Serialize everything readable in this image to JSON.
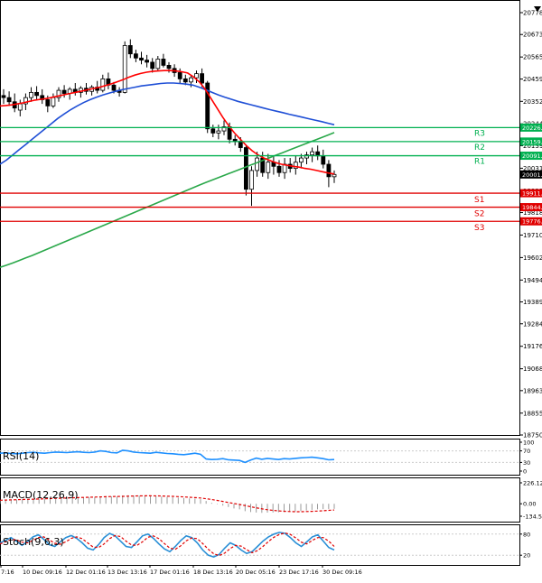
{
  "chart": {
    "corner_icon": "settings-icon",
    "colors": {
      "background": "#ffffff",
      "border": "#000000",
      "grid": "#d6d6d6",
      "candle_up": "#000000",
      "candle_down": "#000000",
      "ma_red": "#ff0000",
      "ma_blue": "#1f4fd6",
      "ma_green": "#2aa84a",
      "resistance": "#00b050",
      "support": "#e00000",
      "rsi_line": "#1e90ff",
      "macd_hist": "#9a9a9a",
      "macd_signal": "#e00000",
      "stoch_main": "#2a8fd6",
      "stoch_signal": "#e00000"
    }
  },
  "chart_data": [
    {
      "type": "candlestick",
      "price_axis_labels": [
        "20778.",
        "20673.",
        "20565.",
        "20459.",
        "20352.",
        "20244.",
        "20139.",
        "20031.",
        "19922.",
        "19818.",
        "19710.",
        "19602.",
        "19494.",
        "19389.",
        "19284.",
        "19176.",
        "19068.",
        "18963.",
        "18855.",
        "18750."
      ],
      "time_labels": [
        "7:16",
        "10 Dec 09:16",
        "12 Dec 01:16",
        "13 Dec 13:16",
        "17 Dec 01:16",
        "18 Dec 13:16",
        "20 Dec 05:16",
        "23 Dec 17:16",
        "30 Dec 09:16"
      ],
      "current_price": "20001.",
      "levels": [
        {
          "name": "R3",
          "value": 20226,
          "tag": "20226.",
          "kind": "resistance"
        },
        {
          "name": "R2",
          "value": 20159,
          "tag": "20159.",
          "kind": "resistance"
        },
        {
          "name": "R1",
          "value": 20091,
          "tag": "20091.",
          "kind": "resistance"
        },
        {
          "name": "S1",
          "value": 19911,
          "tag": "19911.",
          "kind": "support"
        },
        {
          "name": "S2",
          "value": 19844,
          "tag": "19844.",
          "kind": "support"
        },
        {
          "name": "S3",
          "value": 19776,
          "tag": "19776.",
          "kind": "support"
        }
      ],
      "candles": [
        {
          "o": 20380,
          "h": 20410,
          "l": 20340,
          "c": 20370
        },
        {
          "o": 20370,
          "h": 20400,
          "l": 20330,
          "c": 20350
        },
        {
          "o": 20350,
          "h": 20390,
          "l": 20300,
          "c": 20320
        },
        {
          "o": 20310,
          "h": 20360,
          "l": 20280,
          "c": 20340
        },
        {
          "o": 20340,
          "h": 20390,
          "l": 20310,
          "c": 20370
        },
        {
          "o": 20370,
          "h": 20420,
          "l": 20350,
          "c": 20395
        },
        {
          "o": 20395,
          "h": 20425,
          "l": 20360,
          "c": 20380
        },
        {
          "o": 20380,
          "h": 20410,
          "l": 20340,
          "c": 20360
        },
        {
          "o": 20360,
          "h": 20380,
          "l": 20300,
          "c": 20330
        },
        {
          "o": 20330,
          "h": 20390,
          "l": 20320,
          "c": 20370
        },
        {
          "o": 20370,
          "h": 20420,
          "l": 20350,
          "c": 20405
        },
        {
          "o": 20405,
          "h": 20430,
          "l": 20370,
          "c": 20390
        },
        {
          "o": 20390,
          "h": 20420,
          "l": 20360,
          "c": 20410
        },
        {
          "o": 20410,
          "h": 20440,
          "l": 20380,
          "c": 20395
        },
        {
          "o": 20395,
          "h": 20425,
          "l": 20370,
          "c": 20415
        },
        {
          "o": 20415,
          "h": 20440,
          "l": 20385,
          "c": 20400
        },
        {
          "o": 20400,
          "h": 20430,
          "l": 20380,
          "c": 20420
        },
        {
          "o": 20420,
          "h": 20450,
          "l": 20390,
          "c": 20405
        },
        {
          "o": 20405,
          "h": 20480,
          "l": 20395,
          "c": 20460
        },
        {
          "o": 20460,
          "h": 20490,
          "l": 20410,
          "c": 20430
        },
        {
          "o": 20430,
          "h": 20445,
          "l": 20390,
          "c": 20405
        },
        {
          "o": 20405,
          "h": 20420,
          "l": 20375,
          "c": 20395
        },
        {
          "o": 20395,
          "h": 20640,
          "l": 20390,
          "c": 20620
        },
        {
          "o": 20620,
          "h": 20650,
          "l": 20560,
          "c": 20580
        },
        {
          "o": 20580,
          "h": 20600,
          "l": 20540,
          "c": 20560
        },
        {
          "o": 20560,
          "h": 20590,
          "l": 20530,
          "c": 20550
        },
        {
          "o": 20550,
          "h": 20575,
          "l": 20515,
          "c": 20540
        },
        {
          "o": 20540,
          "h": 20560,
          "l": 20490,
          "c": 20510
        },
        {
          "o": 20510,
          "h": 20570,
          "l": 20500,
          "c": 20555
        },
        {
          "o": 20555,
          "h": 20580,
          "l": 20515,
          "c": 20525
        },
        {
          "o": 20525,
          "h": 20540,
          "l": 20490,
          "c": 20510
        },
        {
          "o": 20510,
          "h": 20530,
          "l": 20470,
          "c": 20490
        },
        {
          "o": 20490,
          "h": 20510,
          "l": 20440,
          "c": 20460
        },
        {
          "o": 20460,
          "h": 20480,
          "l": 20430,
          "c": 20445
        },
        {
          "o": 20445,
          "h": 20475,
          "l": 20420,
          "c": 20465
        },
        {
          "o": 20465,
          "h": 20500,
          "l": 20440,
          "c": 20485
        },
        {
          "o": 20485,
          "h": 20510,
          "l": 20420,
          "c": 20440
        },
        {
          "o": 20440,
          "h": 20450,
          "l": 20200,
          "c": 20220
        },
        {
          "o": 20220,
          "h": 20240,
          "l": 20180,
          "c": 20200
        },
        {
          "o": 20200,
          "h": 20240,
          "l": 20170,
          "c": 20210
        },
        {
          "o": 20210,
          "h": 20260,
          "l": 20190,
          "c": 20230
        },
        {
          "o": 20230,
          "h": 20250,
          "l": 20150,
          "c": 20170
        },
        {
          "o": 20170,
          "h": 20190,
          "l": 20140,
          "c": 20160
        },
        {
          "o": 20160,
          "h": 20180,
          "l": 20110,
          "c": 20130
        },
        {
          "o": 20130,
          "h": 20140,
          "l": 19900,
          "c": 19930
        },
        {
          "o": 19930,
          "h": 20040,
          "l": 19850,
          "c": 20020
        },
        {
          "o": 20020,
          "h": 20110,
          "l": 19990,
          "c": 20080
        },
        {
          "o": 20080,
          "h": 20110,
          "l": 19990,
          "c": 20010
        },
        {
          "o": 20010,
          "h": 20100,
          "l": 19980,
          "c": 20060
        },
        {
          "o": 20060,
          "h": 20090,
          "l": 20000,
          "c": 20040
        },
        {
          "o": 20040,
          "h": 20070,
          "l": 19990,
          "c": 20010
        },
        {
          "o": 20010,
          "h": 20080,
          "l": 19980,
          "c": 20050
        },
        {
          "o": 20050,
          "h": 20080,
          "l": 20010,
          "c": 20030
        },
        {
          "o": 20030,
          "h": 20090,
          "l": 20000,
          "c": 20060
        },
        {
          "o": 20060,
          "h": 20100,
          "l": 20030,
          "c": 20080
        },
        {
          "o": 20080,
          "h": 20110,
          "l": 20050,
          "c": 20095
        },
        {
          "o": 20095,
          "h": 20130,
          "l": 20060,
          "c": 20110
        },
        {
          "o": 20110,
          "h": 20140,
          "l": 20070,
          "c": 20090
        },
        {
          "o": 20090,
          "h": 20120,
          "l": 20030,
          "c": 20050
        },
        {
          "o": 20050,
          "h": 20070,
          "l": 19940,
          "c": 19990
        },
        {
          "o": 19990,
          "h": 20020,
          "l": 19960,
          "c": 20001
        }
      ],
      "ma_red": [
        20330,
        20332,
        20335,
        20340,
        20345,
        20352,
        20358,
        20362,
        20366,
        20372,
        20378,
        20384,
        20390,
        20396,
        20402,
        20408,
        20414,
        20420,
        20428,
        20436,
        20446,
        20456,
        20468,
        20478,
        20486,
        20492,
        20496,
        20498,
        20500,
        20500,
        20498,
        20494,
        20488,
        20470,
        20445,
        20410,
        20365,
        20320,
        20275,
        20235,
        20200,
        20170,
        20140,
        20115,
        20095,
        20080,
        20068,
        20058,
        20050,
        20045,
        20040,
        20036,
        20030,
        20026,
        20020,
        20014,
        20008,
        20003
      ],
      "ma_blue": [
        20050,
        20070,
        20095,
        20120,
        20145,
        20170,
        20195,
        20220,
        20245,
        20270,
        20292,
        20312,
        20330,
        20346,
        20360,
        20372,
        20383,
        20392,
        20400,
        20408,
        20414,
        20420,
        20426,
        20430,
        20434,
        20438,
        20440,
        20440,
        20438,
        20435,
        20430,
        20420,
        20408,
        20395,
        20383,
        20372,
        20362,
        20352,
        20344,
        20336,
        20328,
        20320,
        20312,
        20305,
        20298,
        20290,
        20283,
        20276,
        20269,
        20262,
        20255,
        20247,
        20240
      ],
      "ma_green": [
        19555,
        19565,
        19576,
        19588,
        19600,
        19612,
        19625,
        19638,
        19651,
        19664,
        19677,
        19690,
        19703,
        19716,
        19729,
        19742,
        19755,
        19768,
        19781,
        19794,
        19807,
        19820,
        19833,
        19846,
        19859,
        19872,
        19885,
        19898,
        19911,
        19924,
        19937,
        19950,
        19962,
        19974,
        19986,
        19998,
        20010,
        20022,
        20034,
        20046,
        20058,
        20070,
        20082,
        20094,
        20106,
        20118,
        20130,
        20142,
        20154,
        20166,
        20178,
        20190,
        20202
      ],
      "panels": [
        {
          "name": "RSI(14)",
          "axis_labels": [
            "100",
            "70",
            "30",
            "0"
          ],
          "levels": [
            100,
            70,
            30,
            0
          ],
          "values": [
            62,
            63,
            61,
            60,
            62,
            64,
            65,
            63,
            62,
            64,
            66,
            65,
            64,
            66,
            67,
            65,
            64,
            66,
            70,
            68,
            64,
            63,
            72,
            70,
            66,
            64,
            63,
            62,
            65,
            63,
            61,
            60,
            58,
            57,
            59,
            62,
            58,
            42,
            40,
            41,
            43,
            39,
            38,
            37,
            30,
            38,
            45,
            41,
            44,
            42,
            40,
            43,
            42,
            44,
            46,
            47,
            48,
            46,
            43,
            39,
            40
          ]
        },
        {
          "name": "MACD(12,26,9)",
          "axis_labels": [
            "226.12",
            "0.00",
            "-134.58"
          ],
          "axis_values": [
            226.12,
            0,
            -134.58
          ],
          "hist": [
            40,
            42,
            44,
            46,
            48,
            50,
            52,
            54,
            56,
            58,
            60,
            62,
            64,
            66,
            68,
            70,
            72,
            74,
            80,
            82,
            80,
            78,
            90,
            92,
            90,
            88,
            85,
            82,
            80,
            78,
            74,
            70,
            66,
            62,
            58,
            56,
            50,
            30,
            10,
            -5,
            -20,
            -35,
            -50,
            -60,
            -80,
            -90,
            -95,
            -98,
            -96,
            -94,
            -92,
            -90,
            -86,
            -82,
            -78,
            -72,
            -66,
            -60,
            -58,
            -56,
            -55
          ],
          "signal": [
            38,
            40,
            42,
            44,
            46,
            48,
            50,
            52,
            54,
            56,
            58,
            60,
            62,
            64,
            66,
            68,
            70,
            72,
            74,
            76,
            78,
            79,
            80,
            82,
            84,
            85,
            86,
            86,
            85,
            84,
            82,
            80,
            77,
            74,
            70,
            66,
            62,
            55,
            46,
            36,
            25,
            14,
            3,
            -8,
            -20,
            -32,
            -44,
            -55,
            -64,
            -71,
            -77,
            -81,
            -84,
            -86,
            -86,
            -84,
            -82,
            -79,
            -75,
            -71,
            -67
          ]
        },
        {
          "name": "Stoch(9,6,3)",
          "axis_labels": [
            "80",
            "20"
          ],
          "levels": [
            80,
            20
          ],
          "main": [
            55,
            62,
            70,
            60,
            48,
            58,
            72,
            78,
            65,
            50,
            45,
            58,
            70,
            76,
            68,
            55,
            40,
            35,
            50,
            70,
            82,
            75,
            60,
            45,
            42,
            58,
            75,
            80,
            68,
            52,
            38,
            30,
            45,
            62,
            75,
            70,
            55,
            35,
            20,
            15,
            22,
            40,
            55,
            48,
            35,
            25,
            30,
            45,
            60,
            72,
            80,
            85,
            82,
            70,
            55,
            45,
            58,
            72,
            78,
            60,
            42,
            35
          ],
          "signal": [
            52,
            58,
            64,
            64,
            57,
            55,
            62,
            70,
            72,
            63,
            54,
            51,
            58,
            68,
            72,
            67,
            55,
            43,
            42,
            52,
            67,
            76,
            73,
            60,
            49,
            48,
            58,
            71,
            75,
            67,
            53,
            40,
            37,
            47,
            61,
            69,
            67,
            53,
            37,
            24,
            19,
            26,
            39,
            48,
            46,
            36,
            27,
            33,
            45,
            59,
            71,
            79,
            83,
            79,
            69,
            57,
            52,
            62,
            70,
            70,
            60,
            45
          ]
        }
      ]
    }
  ]
}
